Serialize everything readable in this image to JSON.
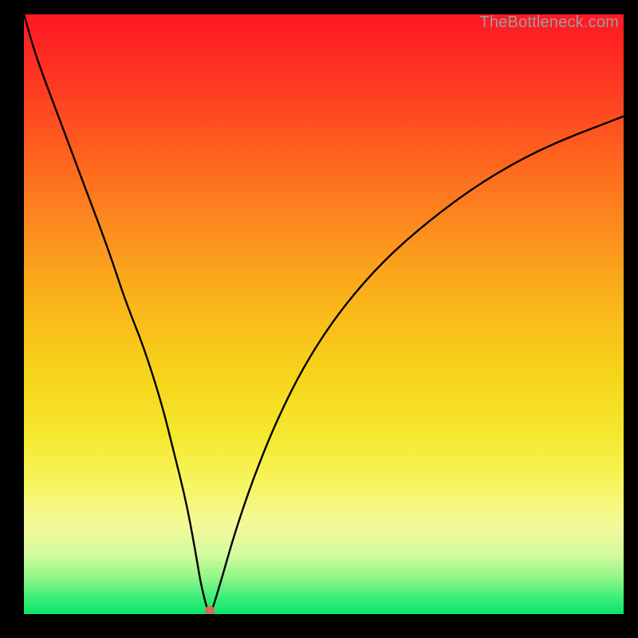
{
  "watermark": "TheBottleneck.com",
  "chart_data": {
    "type": "line",
    "title": "",
    "xlabel": "",
    "ylabel": "",
    "xlim": [
      0,
      100
    ],
    "ylim": [
      0,
      100
    ],
    "gradient_stops": [
      {
        "pct": 0,
        "color": "#fe1824"
      },
      {
        "pct": 10,
        "color": "#fe3422"
      },
      {
        "pct": 22,
        "color": "#fe5d1e"
      },
      {
        "pct": 36,
        "color": "#fc8d20"
      },
      {
        "pct": 48,
        "color": "#fab51a"
      },
      {
        "pct": 60,
        "color": "#f6d41b"
      },
      {
        "pct": 70,
        "color": "#f5e72e"
      },
      {
        "pct": 78,
        "color": "#f7f55d"
      },
      {
        "pct": 85,
        "color": "#f4f899"
      },
      {
        "pct": 90,
        "color": "#d4fb9e"
      },
      {
        "pct": 94,
        "color": "#90f687"
      },
      {
        "pct": 97,
        "color": "#42ee7a"
      },
      {
        "pct": 100,
        "color": "#09e56d"
      }
    ],
    "series": [
      {
        "name": "bottleneck-curve",
        "color": "#000000",
        "x": [
          0,
          2,
          5,
          8,
          11,
          14,
          17,
          20,
          23,
          25,
          27,
          28.5,
          29.5,
          30.5,
          31,
          31.5,
          33,
          35,
          38,
          42,
          47,
          53,
          60,
          68,
          77,
          87,
          100
        ],
        "values": [
          100,
          93,
          85,
          77,
          69,
          61,
          52,
          44.5,
          35,
          27,
          19,
          11,
          5,
          1,
          0,
          1,
          6,
          13,
          22,
          32,
          42,
          51,
          59,
          66,
          72.5,
          78,
          83
        ]
      }
    ],
    "marker": {
      "x": 31,
      "y": 0.6,
      "color": "#d46a5f",
      "radius_px": 6
    },
    "flat_bottom": {
      "x_from": 28.6,
      "x_to": 31,
      "y": 0
    }
  }
}
